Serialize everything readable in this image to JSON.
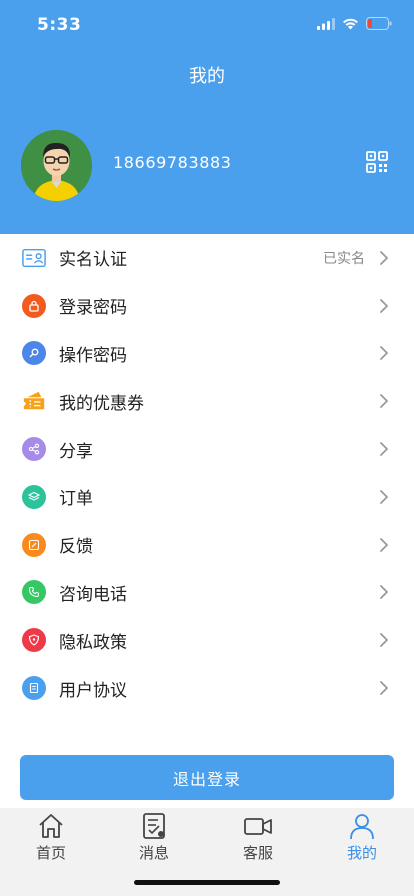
{
  "status_bar": {
    "time": "5:33"
  },
  "header": {
    "title": "我的"
  },
  "profile": {
    "phone": "18669783883"
  },
  "menu": {
    "items": [
      {
        "label": "实名认证",
        "value": "已实名",
        "icon": "id-card-icon",
        "color": "#4aa0ec"
      },
      {
        "label": "登录密码",
        "value": "",
        "icon": "lock-icon",
        "color": "#f25a1e"
      },
      {
        "label": "操作密码",
        "value": "",
        "icon": "key-icon",
        "color": "#4b86e8"
      },
      {
        "label": "我的优惠券",
        "value": "",
        "icon": "coupon-icon",
        "color": "#f7a21b"
      },
      {
        "label": "分享",
        "value": "",
        "icon": "share-icon",
        "color": "#a68be8"
      },
      {
        "label": "订单",
        "value": "",
        "icon": "layers-icon",
        "color": "#2cc39a"
      },
      {
        "label": "反馈",
        "value": "",
        "icon": "edit-icon",
        "color": "#f98a1b"
      },
      {
        "label": "咨询电话",
        "value": "",
        "icon": "phone-icon",
        "color": "#36c765"
      },
      {
        "label": "隐私政策",
        "value": "",
        "icon": "shield-icon",
        "color": "#ee3a48"
      },
      {
        "label": "用户协议",
        "value": "",
        "icon": "document-icon",
        "color": "#4aa0ec"
      }
    ]
  },
  "logout": {
    "label": "退出登录"
  },
  "tabbar": {
    "items": [
      {
        "label": "首页"
      },
      {
        "label": "消息"
      },
      {
        "label": "客服"
      },
      {
        "label": "我的"
      }
    ],
    "active_color": "#3b8fe6"
  },
  "colors": {
    "primary": "#4aa0ec"
  }
}
